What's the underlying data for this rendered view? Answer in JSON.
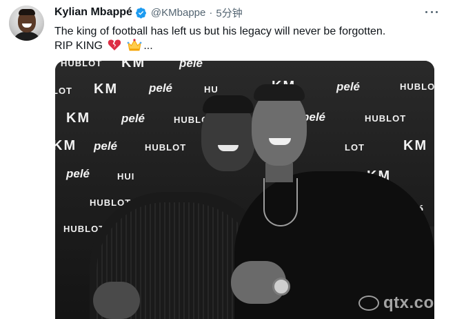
{
  "tweet": {
    "author": {
      "display_name": "Kylian Mbappé",
      "handle": "@KMbappe",
      "verified_icon": "verified-badge-icon"
    },
    "separator": "·",
    "timestamp": "5分钟",
    "more_icon": "more-options-icon",
    "text": {
      "line1": "The king of football has left us but his legacy will never be forgotten.",
      "line2_prefix": "RIP KING",
      "emojis": [
        "broken-heart",
        "crown"
      ],
      "line2_suffix": "..."
    },
    "media": {
      "backdrop_logos": {
        "km": "KM",
        "pele": "pelé",
        "hublot": "HUBLOT",
        "hublot_partial_left": "HUBLOT",
        "hublot_partial_mid": "HUI",
        "hublot_partial_right": "HUBLO",
        "hublot_partial_center": "LOT",
        "pele_small": "pelé",
        "hu_fragment": "HU",
        "lot_fragment": "LOT"
      }
    },
    "watermark": "qtx.com"
  },
  "colors": {
    "text": "#0f1419",
    "secondary": "#536471",
    "verified": "#1d9bf0"
  }
}
